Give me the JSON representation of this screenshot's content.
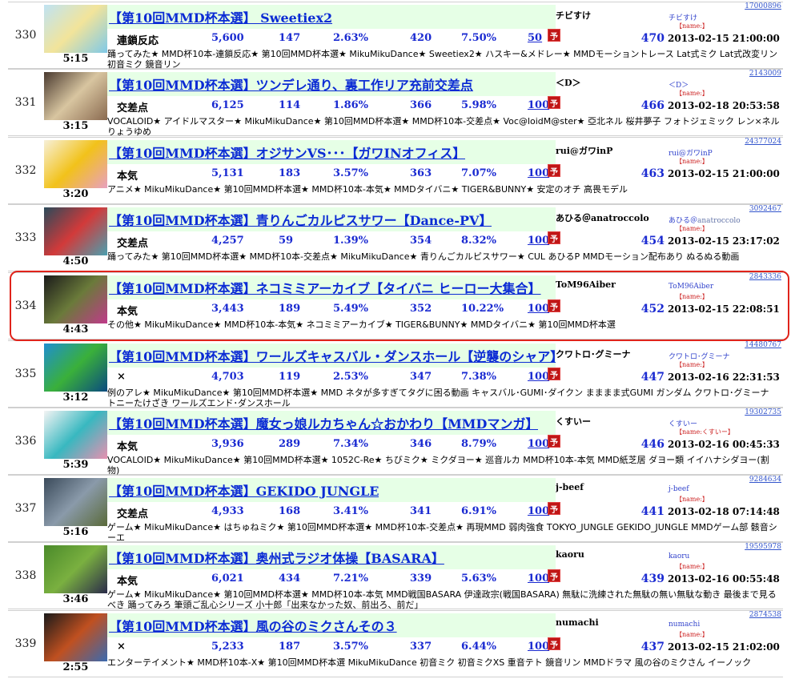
{
  "rows": [
    {
      "rank": "330",
      "duration": "5:15",
      "title": "【第10回MMD杯本選】 Sweetiex2",
      "category": "連鎖反応",
      "views": "5,600",
      "comments": "147",
      "rate": "2.63%",
      "mylist": "420",
      "mylist_rate": "7.50%",
      "ad": "50",
      "score": "470",
      "date": "2013-02-15 21:00:00",
      "uploader": "チビすけ",
      "uploader_link": "チビすけ",
      "uploader_extra": "",
      "name_placeholder": "【name:】",
      "video_id": "17000896",
      "tags": "踊ってみた★ MMD杯10本-連鎖反応★ 第10回MMD杯本選★ MikuMikuDance★ Sweetiex2★ ハスキー&メドレー★ MMDモーショントレース Lat式ミク Lat式改変リン 初音ミク 鏡音リン",
      "thumb_colors": [
        "#bfe3f3",
        "#f2e49a",
        "#7fc9e8"
      ]
    },
    {
      "rank": "331",
      "duration": "3:15",
      "title": "【第10回MMD杯本選】ツンデレ通り、裏工作リア充前交差点",
      "category": "交差点",
      "views": "6,125",
      "comments": "114",
      "rate": "1.86%",
      "mylist": "366",
      "mylist_rate": "5.98%",
      "ad": "100",
      "score": "466",
      "date": "2013-02-18 20:53:58",
      "uploader": "＜D＞",
      "uploader_link": "＜D＞",
      "uploader_extra": "",
      "name_placeholder": "【name:】",
      "video_id": "2143009",
      "tags": "VOCALOID★ アイドルマスター★ MikuMikuDance★ 第10回MMD杯本選★ MMD杯10本-交差点★ Voc@loidM@ster★ 亞北ネル 桜井夢子 フォトジェミック レン×ネル りょうゆめ",
      "thumb_colors": [
        "#4a3a30",
        "#d8c5a0",
        "#8a6a50"
      ]
    },
    {
      "rank": "332",
      "duration": "3:20",
      "title": "【第10回MMD杯本選】オジサンVS･･･【ガワINオフィス】",
      "category": "本気",
      "views": "5,131",
      "comments": "183",
      "rate": "3.57%",
      "mylist": "363",
      "mylist_rate": "7.07%",
      "ad": "100",
      "score": "463",
      "date": "2013-02-15 21:00:00",
      "uploader": "rui@ガワinP",
      "uploader_link": "rui@ガワinP",
      "uploader_extra": "",
      "name_placeholder": "【name:】",
      "video_id": "24377024",
      "tags": "アニメ★ MikuMikuDance★ 第10回MMD杯本選★ MMD杯10本-本気★ MMDタイバニ★ TIGER&BUNNY★ 安定のオチ 高畏モデル",
      "thumb_colors": [
        "#f7f0d8",
        "#f2c21a",
        "#e8a0c0"
      ]
    },
    {
      "rank": "333",
      "duration": "4:50",
      "title": "【第10回MMD杯本選】青りんごカルピスサワー【Dance-PV】",
      "category": "交差点",
      "views": "4,257",
      "comments": "59",
      "rate": "1.39%",
      "mylist": "354",
      "mylist_rate": "8.32%",
      "ad": "100",
      "score": "454",
      "date": "2013-02-15 23:17:02",
      "uploader": "あひる＠anatroccolo",
      "uploader_link": "あひる＠",
      "uploader_extra": "anatroccolo",
      "name_placeholder": "【name:】",
      "video_id": "3092467",
      "tags": "踊ってみた★ 第10回MMD杯本選★ MMD杯10本-交差点★ MikuMikuDance★ 青りんごカルピスサワー★ CUL あひるP MMDモーション配布あり ぬるぬる動画",
      "thumb_colors": [
        "#2a4a5a",
        "#d23a3a",
        "#4aa0b0"
      ]
    },
    {
      "rank": "334",
      "duration": "4:43",
      "title": "【第10回MMD杯本選】ネコミミアーカイブ【タイバニ ヒーロー大集合】",
      "category": "本気",
      "views": "3,443",
      "comments": "189",
      "rate": "5.49%",
      "mylist": "352",
      "mylist_rate": "10.22%",
      "ad": "100",
      "score": "452",
      "date": "2013-02-15 22:08:51",
      "uploader": "ToM96Aiber",
      "uploader_link": "ToM96Aiber",
      "uploader_extra": "",
      "name_placeholder": "【name:】",
      "video_id": "2843336",
      "tags": "その他★ MikuMikuDance★ MMD杯10本-本気★ ネコミミアーカイブ★ TIGER&BUNNY★ MMDタイバニ★ 第10回MMD杯本選",
      "thumb_colors": [
        "#1a1a1a",
        "#6a7a3a",
        "#c03a8a"
      ]
    },
    {
      "rank": "335",
      "duration": "3:12",
      "title": "【第10回MMD杯本選】ワールズキャスバル・ダンスホール【逆襲のシャア】",
      "category": "×",
      "views": "4,703",
      "comments": "119",
      "rate": "2.53%",
      "mylist": "347",
      "mylist_rate": "7.38%",
      "ad": "100",
      "score": "447",
      "date": "2013-02-16 22:31:53",
      "uploader": "クワトロ･グミーナ",
      "uploader_link": "クワトロ･グミーナ",
      "uploader_extra": "",
      "name_placeholder": "【name:】",
      "video_id": "14480767",
      "tags": "例のアレ★ MikuMikuDance★ 第10回MMD杯本選★ MMD ネタが多すぎてタグに困る動画 キャスバル･GUMI･ダイクン まままま式GUMI ガンダム クワトロ･グミーナ トニーたけざき ワールズエンド･ダンスホール",
      "thumb_colors": [
        "#1f8fd0",
        "#3ab03a",
        "#0a4a80"
      ]
    },
    {
      "rank": "336",
      "duration": "5:39",
      "title": "【第10回MMD杯本選】魔女っ娘ルカちゃん☆おかわり【MMDマンガ】",
      "category": "本気",
      "views": "3,936",
      "comments": "289",
      "rate": "7.34%",
      "mylist": "346",
      "mylist_rate": "8.79%",
      "ad": "100",
      "score": "446",
      "date": "2013-02-16 00:45:33",
      "uploader": "くすいー",
      "uploader_link": "くすいー",
      "uploader_extra": "",
      "name_placeholder": "【name:くすいー】",
      "video_id": "19302735",
      "tags": "VOCALOID★ MikuMikuDance★ 第10回MMD杯本選★ 1052C-Re★ ちびミク★ ミクダヨー★ 巡音ルカ MMD杯10本-本気 MMD紙芝居 ダヨー類 イイハナシダヨー(割物)",
      "thumb_colors": [
        "#f4f4f4",
        "#38b8c0",
        "#e890b0"
      ]
    },
    {
      "rank": "337",
      "duration": "5:16",
      "title": "【第10回MMD杯本選】GEKIDO JUNGLE",
      "category": "交差点",
      "views": "4,933",
      "comments": "168",
      "rate": "3.41%",
      "mylist": "341",
      "mylist_rate": "6.91%",
      "ad": "100",
      "score": "441",
      "date": "2013-02-18 07:14:48",
      "uploader": "j-beef",
      "uploader_link": "j-beef",
      "uploader_extra": "",
      "name_placeholder": "【name:】",
      "video_id": "9284634",
      "tags": "ゲーム★ MikuMikuDance★ はちゅねミク★ 第10回MMD杯本選★ MMD杯10本-交差点★ 再現MMD 弱肉強食 TOKYO_JUNGLE GEKIDO_JUNGLE MMDゲーム部 骸音シーエ",
      "thumb_colors": [
        "#3a4a5a",
        "#8a9aaa",
        "#5a6a3a"
      ]
    },
    {
      "rank": "338",
      "duration": "3:46",
      "title": "【第10回MMD杯本選】奥州式ラジオ体操【BASARA】",
      "category": "本気",
      "views": "6,021",
      "comments": "434",
      "rate": "7.21%",
      "mylist": "339",
      "mylist_rate": "5.63%",
      "ad": "100",
      "score": "439",
      "date": "2013-02-16 00:55:48",
      "uploader": "kaoru",
      "uploader_link": "kaoru",
      "uploader_extra": "",
      "name_placeholder": "【name:】",
      "video_id": "19595978",
      "tags": "ゲーム★ MikuMikuDance★ 第10回MMD杯本選★ MMD杯10本-本気 MMD戦国BASARA 伊達政宗(戦国BASARA) 無駄に洗練された無駄の無い無駄な動き 最後まで見るべき 踊ってみろ 筆頭ご乱心シリーズ 小十郎「出来なかった奴、前出ろ、前だ」",
      "thumb_colors": [
        "#4a8a2a",
        "#7ab040",
        "#2a2a4a"
      ]
    },
    {
      "rank": "339",
      "duration": "2:55",
      "title": "【第10回MMD杯本選】風の谷のミクさんその３",
      "category": "×",
      "views": "5,233",
      "comments": "187",
      "rate": "3.57%",
      "mylist": "337",
      "mylist_rate": "6.44%",
      "ad": "100",
      "score": "437",
      "date": "2013-02-15 21:02:00",
      "uploader": "numachi",
      "uploader_link": "numachi",
      "uploader_extra": "",
      "name_placeholder": "【name:】",
      "video_id": "2874538",
      "tags": "エンターテイメント★ MMD杯10本-X★ 第10回MMD杯本選 MikuMikuDance 初音ミク 初音ミクXS 重音テト 鏡音リン MMDドラマ 風の谷のミクさん イーノック",
      "thumb_colors": [
        "#1a1a1a",
        "#c05020",
        "#3a6ab0"
      ]
    }
  ],
  "badge": "予",
  "highlighted_rank": "334"
}
